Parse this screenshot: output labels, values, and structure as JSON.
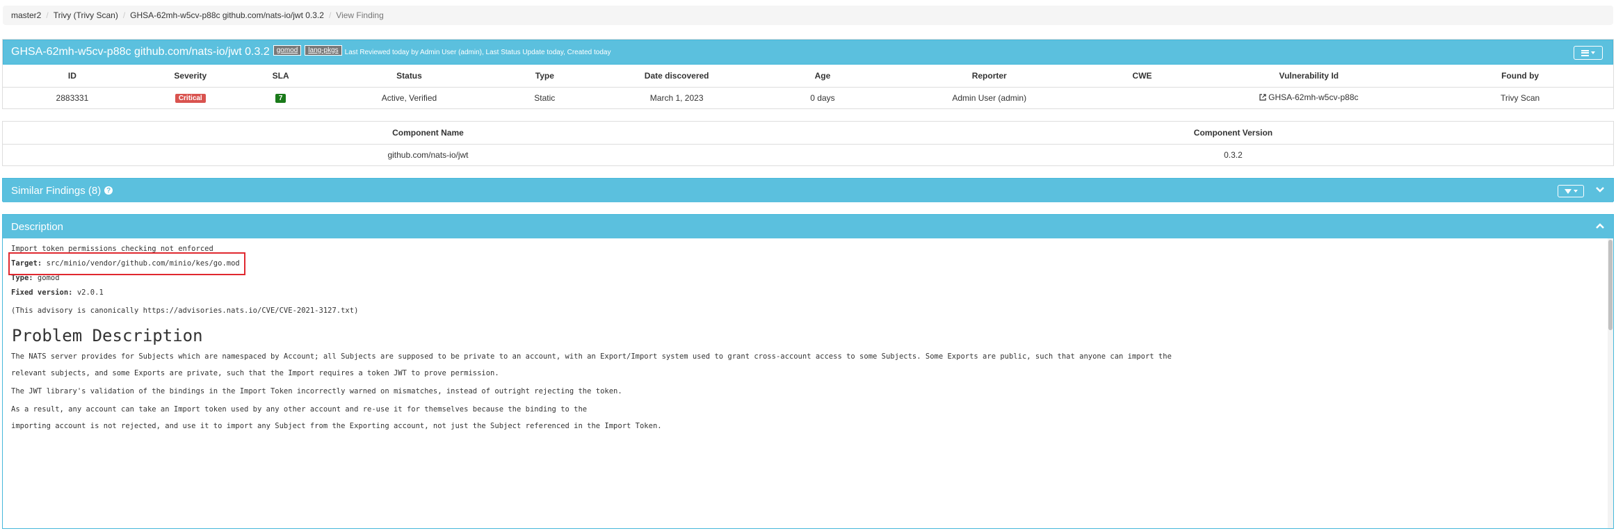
{
  "breadcrumb": [
    {
      "label": "master2"
    },
    {
      "label": "Trivy (Trivy Scan)"
    },
    {
      "label": "GHSA-62mh-w5cv-p88c github.com/nats-io/jwt 0.3.2"
    },
    {
      "label": "View Finding"
    }
  ],
  "finding": {
    "title": "GHSA-62mh-w5cv-p88c github.com/nats-io/jwt 0.3.2",
    "tags": [
      "gomod",
      "lang-pkgs"
    ],
    "meta": "Last Reviewed today by Admin User (admin), Last Status Update today, Created today"
  },
  "details_table": {
    "headers": [
      "ID",
      "Severity",
      "SLA",
      "Status",
      "Type",
      "Date discovered",
      "Age",
      "Reporter",
      "CWE",
      "Vulnerability Id",
      "Found by"
    ],
    "row": {
      "id": "2883331",
      "severity": "Critical",
      "sla": "7",
      "status": "Active, Verified",
      "type": "Static",
      "date_discovered": "March 1, 2023",
      "age": "0 days",
      "reporter": "Admin User (admin)",
      "cwe": "",
      "vulnerability_id": "GHSA-62mh-w5cv-p88c",
      "found_by": "Trivy Scan"
    }
  },
  "component_table": {
    "headers": [
      "Component Name",
      "Component Version"
    ],
    "row": {
      "name": "github.com/nats-io/jwt",
      "version": "0.3.2"
    }
  },
  "similar": {
    "title": "Similar Findings (8)"
  },
  "description": {
    "title": "Description",
    "summary": "Import token permissions checking not enforced",
    "target_label": "Target:",
    "target_value": " src/minio/vendor/github.com/minio/kes/go.mod",
    "type_label": "Type:",
    "type_value": " gomod",
    "fixed_label": "Fixed version:",
    "fixed_value": " v2.0.1",
    "advisory": "(This advisory is canonically https://advisories.nats.io/CVE/CVE-2021-3127.txt)",
    "heading": "Problem Description",
    "p1a": "The NATS server provides for Subjects which are namespaced by Account; all Subjects are supposed to be private to an account, with an Export/Import system used to grant cross-account access to some Subjects.  Some Exports are public, such that anyone can import the",
    "p1b": "relevant subjects, and some Exports are private, such that the Import requires a token JWT to prove permission.",
    "p2": "The JWT library's validation of the bindings in the Import Token incorrectly warned on mismatches, instead of outright rejecting the token.",
    "p3a": "As a result, any account can take an Import token used by any other account and re-use it for themselves because the binding to the",
    "p3b": "importing account is not rejected, and use it to import any Subject from the Exporting account, not just the Subject referenced in the Import Token."
  },
  "colors": {
    "panel_header": "#5bc0de",
    "critical": "#d9534f",
    "sla": "#1a7a1a",
    "highlight": "#e0282f"
  }
}
